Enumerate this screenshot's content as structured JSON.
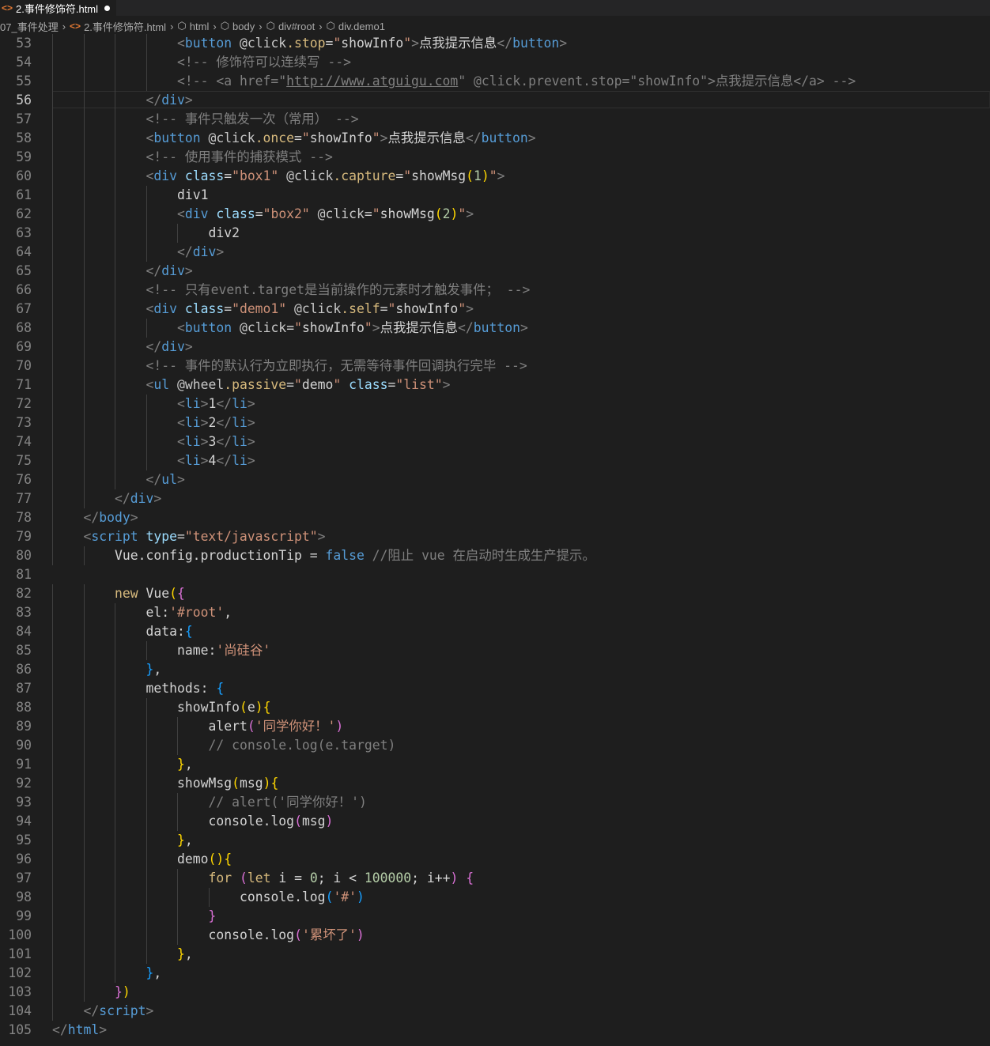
{
  "tab": {
    "title": "2.事件修饰符.html"
  },
  "breadcrumb": [
    "07_事件处理",
    "2.事件修饰符.html",
    "html",
    "body",
    "div#root",
    "div.demo1"
  ],
  "lines": [
    {
      "n": "53",
      "indent": 4,
      "t": [
        [
          "<",
          "t"
        ],
        [
          "button",
          "tag"
        ],
        [
          " ",
          "txt"
        ],
        [
          "@click",
          "ev"
        ],
        [
          ".stop",
          "mod"
        ],
        [
          "=",
          "txt"
        ],
        [
          "\"",
          "str"
        ],
        [
          "showInfo",
          "txt"
        ],
        [
          "\"",
          "str"
        ],
        [
          ">",
          "t"
        ],
        [
          "点我提示信息",
          "txt"
        ],
        [
          "</",
          "t"
        ],
        [
          "button",
          "tag"
        ],
        [
          ">",
          "t"
        ]
      ]
    },
    {
      "n": "54",
      "indent": 4,
      "t": [
        [
          "<!-- 修饰符可以连续写 -->",
          "cmg"
        ]
      ]
    },
    {
      "n": "55",
      "indent": 4,
      "t": [
        [
          "<!-- <a href=\"",
          "cmg"
        ],
        [
          "http://www.atguigu.com",
          "cmg link"
        ],
        [
          "\" @click.prevent.stop=\"showInfo\">点我提示信息</a> -->",
          "cmg"
        ]
      ]
    },
    {
      "n": "56",
      "indent": 3,
      "active": true,
      "t": [
        [
          "</",
          "t"
        ],
        [
          "div",
          "tag"
        ],
        [
          ">",
          "t"
        ]
      ]
    },
    {
      "n": "57",
      "indent": 3,
      "t": [
        [
          "<!-- 事件只触发一次（常用） -->",
          "cmg"
        ]
      ]
    },
    {
      "n": "58",
      "indent": 3,
      "t": [
        [
          "<",
          "t"
        ],
        [
          "button",
          "tag"
        ],
        [
          " ",
          "txt"
        ],
        [
          "@click",
          "ev"
        ],
        [
          ".once",
          "mod"
        ],
        [
          "=",
          "txt"
        ],
        [
          "\"",
          "str"
        ],
        [
          "showInfo",
          "txt"
        ],
        [
          "\"",
          "str"
        ],
        [
          ">",
          "t"
        ],
        [
          "点我提示信息",
          "txt"
        ],
        [
          "</",
          "t"
        ],
        [
          "button",
          "tag"
        ],
        [
          ">",
          "t"
        ]
      ]
    },
    {
      "n": "59",
      "indent": 3,
      "t": [
        [
          "<!-- 使用事件的捕获模式 -->",
          "cmg"
        ]
      ]
    },
    {
      "n": "60",
      "indent": 3,
      "t": [
        [
          "<",
          "t"
        ],
        [
          "div",
          "tag"
        ],
        [
          " ",
          "txt"
        ],
        [
          "class",
          "attr"
        ],
        [
          "=",
          "txt"
        ],
        [
          "\"box1\"",
          "str"
        ],
        [
          " ",
          "txt"
        ],
        [
          "@click",
          "ev"
        ],
        [
          ".capture",
          "mod"
        ],
        [
          "=",
          "txt"
        ],
        [
          "\"",
          "str"
        ],
        [
          "showMsg",
          "txt"
        ],
        [
          "(",
          "br1"
        ],
        [
          "1",
          "num"
        ],
        [
          ")",
          "br1"
        ],
        [
          "\"",
          "str"
        ],
        [
          ">",
          "t"
        ]
      ]
    },
    {
      "n": "61",
      "indent": 4,
      "t": [
        [
          "div1",
          "txt"
        ]
      ]
    },
    {
      "n": "62",
      "indent": 4,
      "t": [
        [
          "<",
          "t"
        ],
        [
          "div",
          "tag"
        ],
        [
          " ",
          "txt"
        ],
        [
          "class",
          "attr"
        ],
        [
          "=",
          "txt"
        ],
        [
          "\"box2\"",
          "str"
        ],
        [
          " ",
          "txt"
        ],
        [
          "@click",
          "ev"
        ],
        [
          "=",
          "txt"
        ],
        [
          "\"",
          "str"
        ],
        [
          "showMsg",
          "txt"
        ],
        [
          "(",
          "br1"
        ],
        [
          "2",
          "num"
        ],
        [
          ")",
          "br1"
        ],
        [
          "\"",
          "str"
        ],
        [
          ">",
          "t"
        ]
      ]
    },
    {
      "n": "63",
      "indent": 5,
      "t": [
        [
          "div2",
          "txt"
        ]
      ]
    },
    {
      "n": "64",
      "indent": 4,
      "t": [
        [
          "</",
          "t"
        ],
        [
          "div",
          "tag"
        ],
        [
          ">",
          "t"
        ]
      ]
    },
    {
      "n": "65",
      "indent": 3,
      "t": [
        [
          "</",
          "t"
        ],
        [
          "div",
          "tag"
        ],
        [
          ">",
          "t"
        ]
      ]
    },
    {
      "n": "66",
      "indent": 3,
      "t": [
        [
          "<!-- 只有event.target是当前操作的元素时才触发事件； -->",
          "cmg"
        ]
      ]
    },
    {
      "n": "67",
      "indent": 3,
      "t": [
        [
          "<",
          "t"
        ],
        [
          "div",
          "tag"
        ],
        [
          " ",
          "txt"
        ],
        [
          "class",
          "attr"
        ],
        [
          "=",
          "txt"
        ],
        [
          "\"demo1\"",
          "str"
        ],
        [
          " ",
          "txt"
        ],
        [
          "@click",
          "ev"
        ],
        [
          ".self",
          "mod"
        ],
        [
          "=",
          "txt"
        ],
        [
          "\"",
          "str"
        ],
        [
          "showInfo",
          "txt"
        ],
        [
          "\"",
          "str"
        ],
        [
          ">",
          "t"
        ]
      ]
    },
    {
      "n": "68",
      "indent": 4,
      "t": [
        [
          "<",
          "t"
        ],
        [
          "button",
          "tag"
        ],
        [
          " ",
          "txt"
        ],
        [
          "@click",
          "ev"
        ],
        [
          "=",
          "txt"
        ],
        [
          "\"",
          "str"
        ],
        [
          "showInfo",
          "txt"
        ],
        [
          "\"",
          "str"
        ],
        [
          ">",
          "t"
        ],
        [
          "点我提示信息",
          "txt"
        ],
        [
          "</",
          "t"
        ],
        [
          "button",
          "tag"
        ],
        [
          ">",
          "t"
        ]
      ]
    },
    {
      "n": "69",
      "indent": 3,
      "t": [
        [
          "</",
          "t"
        ],
        [
          "div",
          "tag"
        ],
        [
          ">",
          "t"
        ]
      ]
    },
    {
      "n": "70",
      "indent": 3,
      "t": [
        [
          "<!-- 事件的默认行为立即执行，无需等待事件回调执行完毕 -->",
          "cmg"
        ]
      ]
    },
    {
      "n": "71",
      "indent": 3,
      "t": [
        [
          "<",
          "t"
        ],
        [
          "ul",
          "tag"
        ],
        [
          " ",
          "txt"
        ],
        [
          "@wheel",
          "ev"
        ],
        [
          ".passive",
          "mod"
        ],
        [
          "=",
          "txt"
        ],
        [
          "\"",
          "str"
        ],
        [
          "demo",
          "txt"
        ],
        [
          "\"",
          "str"
        ],
        [
          " ",
          "txt"
        ],
        [
          "class",
          "attr"
        ],
        [
          "=",
          "txt"
        ],
        [
          "\"list\"",
          "str"
        ],
        [
          ">",
          "t"
        ]
      ]
    },
    {
      "n": "72",
      "indent": 4,
      "t": [
        [
          "<",
          "t"
        ],
        [
          "li",
          "tag"
        ],
        [
          ">",
          "t"
        ],
        [
          "1",
          "txt"
        ],
        [
          "</",
          "t"
        ],
        [
          "li",
          "tag"
        ],
        [
          ">",
          "t"
        ]
      ]
    },
    {
      "n": "73",
      "indent": 4,
      "t": [
        [
          "<",
          "t"
        ],
        [
          "li",
          "tag"
        ],
        [
          ">",
          "t"
        ],
        [
          "2",
          "txt"
        ],
        [
          "</",
          "t"
        ],
        [
          "li",
          "tag"
        ],
        [
          ">",
          "t"
        ]
      ]
    },
    {
      "n": "74",
      "indent": 4,
      "t": [
        [
          "<",
          "t"
        ],
        [
          "li",
          "tag"
        ],
        [
          ">",
          "t"
        ],
        [
          "3",
          "txt"
        ],
        [
          "</",
          "t"
        ],
        [
          "li",
          "tag"
        ],
        [
          ">",
          "t"
        ]
      ]
    },
    {
      "n": "75",
      "indent": 4,
      "t": [
        [
          "<",
          "t"
        ],
        [
          "li",
          "tag"
        ],
        [
          ">",
          "t"
        ],
        [
          "4",
          "txt"
        ],
        [
          "</",
          "t"
        ],
        [
          "li",
          "tag"
        ],
        [
          ">",
          "t"
        ]
      ]
    },
    {
      "n": "76",
      "indent": 3,
      "t": [
        [
          "</",
          "t"
        ],
        [
          "ul",
          "tag"
        ],
        [
          ">",
          "t"
        ]
      ]
    },
    {
      "n": "77",
      "indent": 2,
      "t": [
        [
          "</",
          "t"
        ],
        [
          "div",
          "tag"
        ],
        [
          ">",
          "t"
        ]
      ]
    },
    {
      "n": "78",
      "indent": 1,
      "t": [
        [
          "</",
          "t"
        ],
        [
          "body",
          "tag"
        ],
        [
          ">",
          "t"
        ]
      ]
    },
    {
      "n": "79",
      "indent": 1,
      "t": [
        [
          "<",
          "t"
        ],
        [
          "script",
          "tag"
        ],
        [
          " ",
          "txt"
        ],
        [
          "type",
          "attr"
        ],
        [
          "=",
          "txt"
        ],
        [
          "\"text/javascript\"",
          "str"
        ],
        [
          ">",
          "t"
        ]
      ]
    },
    {
      "n": "80",
      "indent": 2,
      "t": [
        [
          "Vue",
          "txt"
        ],
        [
          ".config.productionTip ",
          "txt"
        ],
        [
          "= ",
          "txt"
        ],
        [
          "false",
          "kw"
        ],
        [
          " //阻止 vue 在启动时生成生产提示。",
          "cmg"
        ]
      ]
    },
    {
      "n": "81",
      "indent": 0,
      "t": []
    },
    {
      "n": "82",
      "indent": 2,
      "t": [
        [
          "new",
          "mod"
        ],
        [
          " Vue",
          "txt"
        ],
        [
          "(",
          "br1"
        ],
        [
          "{",
          "br2"
        ]
      ]
    },
    {
      "n": "83",
      "indent": 3,
      "t": [
        [
          "el:",
          "txt"
        ],
        [
          "'#root'",
          "str"
        ],
        [
          ",",
          "txt"
        ]
      ]
    },
    {
      "n": "84",
      "indent": 3,
      "t": [
        [
          "data:",
          "txt"
        ],
        [
          "{",
          "br3"
        ]
      ]
    },
    {
      "n": "85",
      "indent": 4,
      "t": [
        [
          "name:",
          "txt"
        ],
        [
          "'尚硅谷'",
          "str"
        ]
      ]
    },
    {
      "n": "86",
      "indent": 3,
      "t": [
        [
          "}",
          "br3"
        ],
        [
          ",",
          "txt"
        ]
      ]
    },
    {
      "n": "87",
      "indent": 3,
      "t": [
        [
          "methods: ",
          "txt"
        ],
        [
          "{",
          "br3"
        ]
      ]
    },
    {
      "n": "88",
      "indent": 4,
      "t": [
        [
          "showInfo",
          "txt"
        ],
        [
          "(",
          "br1"
        ],
        [
          "e",
          "txt"
        ],
        [
          ")",
          "br1"
        ],
        [
          "{",
          "br1"
        ]
      ]
    },
    {
      "n": "89",
      "indent": 5,
      "t": [
        [
          "alert",
          "txt"
        ],
        [
          "(",
          "br2"
        ],
        [
          "'同学你好！'",
          "str"
        ],
        [
          ")",
          "br2"
        ]
      ]
    },
    {
      "n": "90",
      "indent": 5,
      "t": [
        [
          "// console.log(e.target)",
          "cmg"
        ]
      ]
    },
    {
      "n": "91",
      "indent": 4,
      "t": [
        [
          "}",
          "br1"
        ],
        [
          ",",
          "txt"
        ]
      ]
    },
    {
      "n": "92",
      "indent": 4,
      "t": [
        [
          "showMsg",
          "txt"
        ],
        [
          "(",
          "br1"
        ],
        [
          "msg",
          "txt"
        ],
        [
          ")",
          "br1"
        ],
        [
          "{",
          "br1"
        ]
      ]
    },
    {
      "n": "93",
      "indent": 5,
      "t": [
        [
          "// alert('同学你好！')",
          "cmg"
        ]
      ]
    },
    {
      "n": "94",
      "indent": 5,
      "t": [
        [
          "console.log",
          "txt"
        ],
        [
          "(",
          "br2"
        ],
        [
          "msg",
          "txt"
        ],
        [
          ")",
          "br2"
        ]
      ]
    },
    {
      "n": "95",
      "indent": 4,
      "t": [
        [
          "}",
          "br1"
        ],
        [
          ",",
          "txt"
        ]
      ]
    },
    {
      "n": "96",
      "indent": 4,
      "t": [
        [
          "demo",
          "txt"
        ],
        [
          "(",
          "br1"
        ],
        [
          ")",
          "br1"
        ],
        [
          "{",
          "br1"
        ]
      ]
    },
    {
      "n": "97",
      "indent": 5,
      "t": [
        [
          "for",
          "mod"
        ],
        [
          " ",
          "txt"
        ],
        [
          "(",
          "br2"
        ],
        [
          "let",
          "mod"
        ],
        [
          " i = ",
          "txt"
        ],
        [
          "0",
          "num"
        ],
        [
          "; i < ",
          "txt"
        ],
        [
          "100000",
          "num"
        ],
        [
          "; i++",
          "txt"
        ],
        [
          ")",
          "br2"
        ],
        [
          " ",
          "txt"
        ],
        [
          "{",
          "br2"
        ]
      ]
    },
    {
      "n": "98",
      "indent": 6,
      "t": [
        [
          "console.log",
          "txt"
        ],
        [
          "(",
          "br3"
        ],
        [
          "'#'",
          "str"
        ],
        [
          ")",
          "br3"
        ]
      ]
    },
    {
      "n": "99",
      "indent": 5,
      "t": [
        [
          "}",
          "br2"
        ]
      ]
    },
    {
      "n": "100",
      "indent": 5,
      "t": [
        [
          "console.log",
          "txt"
        ],
        [
          "(",
          "br2"
        ],
        [
          "'累坏了'",
          "str"
        ],
        [
          ")",
          "br2"
        ]
      ]
    },
    {
      "n": "101",
      "indent": 4,
      "t": [
        [
          "}",
          "br1"
        ],
        [
          ",",
          "txt"
        ]
      ]
    },
    {
      "n": "102",
      "indent": 3,
      "t": [
        [
          "}",
          "br3"
        ],
        [
          ",",
          "txt"
        ]
      ]
    },
    {
      "n": "103",
      "indent": 2,
      "t": [
        [
          "}",
          "br2"
        ],
        [
          ")",
          "br1"
        ]
      ]
    },
    {
      "n": "104",
      "indent": 1,
      "t": [
        [
          "</",
          "t"
        ],
        [
          "script",
          "tag"
        ],
        [
          ">",
          "t"
        ]
      ]
    },
    {
      "n": "105",
      "indent": 0,
      "t": [
        [
          "</",
          "t"
        ],
        [
          "html",
          "tag"
        ],
        [
          ">",
          "t"
        ]
      ]
    }
  ]
}
